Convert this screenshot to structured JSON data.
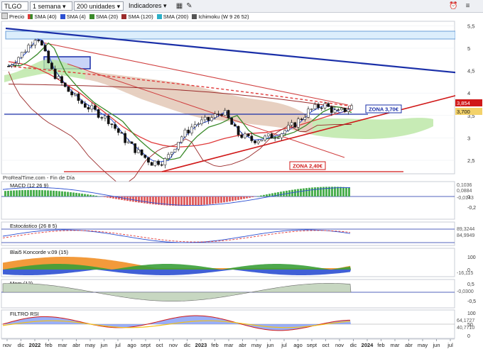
{
  "toolbar": {
    "ticker": "TLGO",
    "timeframe": "1 semana",
    "units": "200 unidades",
    "indicators": "Indicadores"
  },
  "main_legend": [
    {
      "label": "Precio",
      "color": "#d6d6d6"
    },
    {
      "label": "SMA (40)",
      "color": "#e03a3a"
    },
    {
      "label": "SMA (4)",
      "color": "#2b4fd1"
    },
    {
      "label": "SMA (20)",
      "color": "#3a8a2a"
    },
    {
      "label": "SMA (120)",
      "color": "#9b2b2b"
    },
    {
      "label": "SMA (200)",
      "color": "#2bb0c8"
    },
    {
      "label": "Ichimoku (W 9 26 52)",
      "color": "#555555"
    }
  ],
  "annotations": {
    "source": "ProRealTime.com - Fin de Día",
    "zone_high": "ZONA 3,70€",
    "zone_low": "ZONA 2,40€"
  },
  "price_labels": [
    "3,854",
    "3,700"
  ],
  "x_axis": [
    "nov",
    "dic",
    "2022",
    "feb",
    "mar",
    "abr",
    "may",
    "jun",
    "jul",
    "ago",
    "sept",
    "oct",
    "nov",
    "dic",
    "2023",
    "feb",
    "mar",
    "abr",
    "may",
    "jun",
    "jul",
    "ago",
    "sept",
    "oct",
    "nov",
    "dic",
    "2024",
    "feb",
    "mar",
    "abr",
    "may",
    "jun",
    "jul"
  ],
  "chart_data": [
    {
      "type": "candlestick",
      "title": "TLGO",
      "ylim": [
        2.2,
        5.6
      ],
      "yticks": [
        "5,5",
        "5",
        "4,5",
        "4",
        "3,5",
        "3",
        "2,5"
      ],
      "x": [
        "nov",
        "dic",
        "2022",
        "feb",
        "mar",
        "abr",
        "may",
        "jun",
        "jul",
        "ago",
        "sept",
        "oct",
        "nov",
        "dic",
        "2023",
        "feb",
        "mar",
        "abr",
        "may",
        "jun",
        "jul",
        "ago",
        "sept",
        "oct",
        "nov"
      ],
      "series": [
        {
          "name": "Precio",
          "values": [
            4.6,
            4.9,
            5.3,
            4.5,
            4.1,
            3.8,
            3.6,
            3.4,
            3.0,
            2.7,
            2.45,
            2.5,
            3.0,
            3.3,
            3.4,
            3.6,
            3.1,
            2.95,
            3.0,
            3.1,
            3.3,
            3.6,
            3.75,
            3.55,
            3.7
          ]
        },
        {
          "name": "SMA (40)",
          "values": [
            4.7,
            4.65,
            4.55,
            4.4,
            4.2,
            4.0,
            3.75,
            3.5,
            3.25,
            3.05,
            2.9,
            2.82,
            2.8,
            2.82,
            2.88,
            2.98,
            3.05,
            3.1,
            3.12,
            3.18,
            3.25,
            3.35,
            3.45,
            3.55,
            3.62
          ]
        }
      ]
    },
    {
      "type": "bar",
      "title": "MACD (12 26 9)",
      "ylim": [
        -0.25,
        0.15
      ],
      "yticks": [
        "0",
        "-0,2"
      ],
      "value_labels": [
        "0,1036",
        "0,0884",
        "-0,0143"
      ]
    },
    {
      "type": "line",
      "title": "Estocástico (26 8 5)",
      "value_labels": [
        "89,3244",
        "84,9949"
      ]
    },
    {
      "type": "area",
      "title": "Blai5 Koncorde v.09 (15)",
      "yticks": [
        "100",
        "0"
      ],
      "value_labels": [
        "-16,115"
      ]
    },
    {
      "type": "area",
      "title": "Mom (12)",
      "yticks": [
        "0,5",
        "-0,5"
      ],
      "value_labels": [
        "-0,0300"
      ]
    },
    {
      "type": "area",
      "title": "FILTRO RSI",
      "yticks": [
        "100",
        "50",
        "0"
      ],
      "value_labels": [
        "64,1727",
        "40,7710"
      ]
    }
  ]
}
